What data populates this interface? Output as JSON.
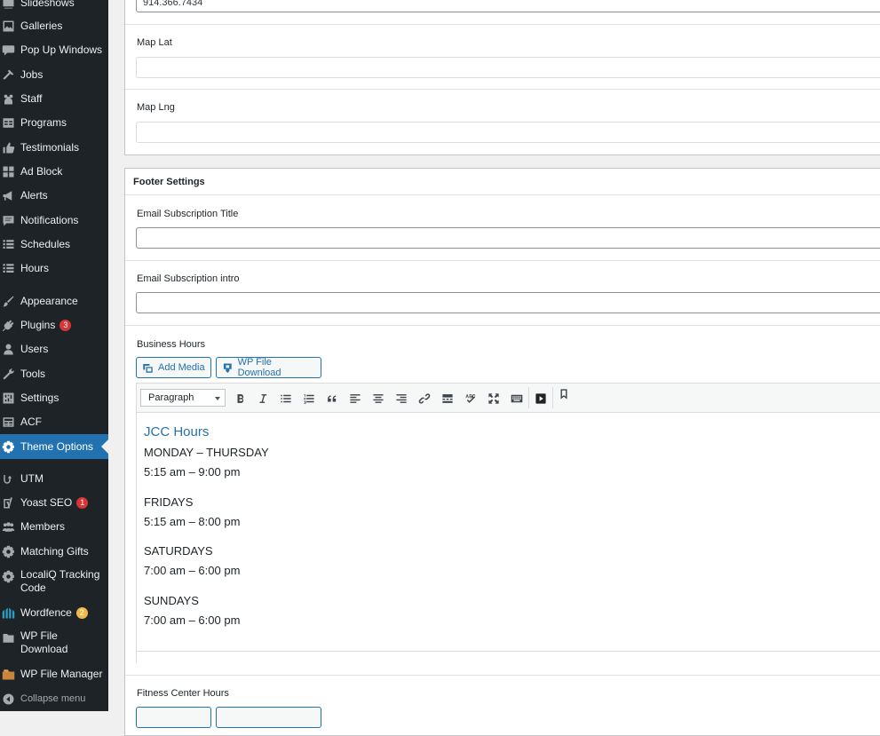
{
  "sidebar": {
    "items": [
      {
        "label": "Slideshows",
        "icon": "slideshow-icon"
      },
      {
        "label": "Galleries",
        "icon": "gallery-icon"
      },
      {
        "label": "Pop Up Windows",
        "icon": "speech-bubble-icon"
      },
      {
        "label": "Jobs",
        "icon": "hammer-icon"
      },
      {
        "label": "Staff",
        "icon": "groups-icon"
      },
      {
        "label": "Programs",
        "icon": "table-icon"
      },
      {
        "label": "Testimonials",
        "icon": "thumbs-up-icon"
      },
      {
        "label": "Ad Block",
        "icon": "grid-icon"
      },
      {
        "label": "Alerts",
        "icon": "megaphone-icon"
      },
      {
        "label": "Notifications",
        "icon": "comment-icon"
      },
      {
        "label": "Schedules",
        "icon": "list-icon"
      },
      {
        "label": "Hours",
        "icon": "list-icon"
      },
      {
        "label": "Appearance",
        "icon": "paintbrush-icon"
      },
      {
        "label": "Plugins",
        "icon": "plug-icon",
        "badge": "3"
      },
      {
        "label": "Users",
        "icon": "user-icon"
      },
      {
        "label": "Tools",
        "icon": "wrench-icon"
      },
      {
        "label": "Settings",
        "icon": "settings-sliders-icon"
      },
      {
        "label": "ACF",
        "icon": "acf-icon"
      },
      {
        "label": "Theme Options",
        "icon": "gear-icon"
      },
      {
        "label": "UTM",
        "icon": "utm-icon"
      },
      {
        "label": "Yoast SEO",
        "icon": "yoast-icon",
        "badge": "1"
      },
      {
        "label": "Members",
        "icon": "members-icon"
      },
      {
        "label": "Matching Gifts",
        "icon": "gear-icon"
      },
      {
        "label": "LocaliQ Tracking Code",
        "icon": "gear-icon"
      },
      {
        "label": "Wordfence",
        "icon": "wordfence-icon",
        "badge": "2"
      },
      {
        "label": "WP File Download",
        "icon": "folder-icon"
      },
      {
        "label": "WP File Manager",
        "icon": "file-manager-icon"
      }
    ],
    "collapse_label": "Collapse menu"
  },
  "contact": {
    "phone_value": "914.366.7434",
    "map_lat_label": "Map Lat",
    "map_lng_label": "Map Lng"
  },
  "footer_settings": {
    "title": "Footer Settings",
    "email_sub_title_label": "Email Subscription Title",
    "email_sub_intro_label": "Email Subscription intro",
    "business_hours_label": "Business Hours",
    "add_media_label": "Add Media",
    "wp_file_download_label": "WP File Download",
    "format_select_value": "Paragraph",
    "editor": {
      "heading": "JCC Hours",
      "lines": [
        "MONDAY – THURSDAY",
        "5:15 am – 9:00 pm",
        "FRIDAYS",
        "5:15 am – 8:00 pm",
        "SATURDAYS",
        "7:00 am – 6:00 pm",
        "SUNDAYS",
        "7:00 am – 6:00 pm"
      ]
    },
    "fitness_center_hours_label": "Fitness Center Hours"
  }
}
